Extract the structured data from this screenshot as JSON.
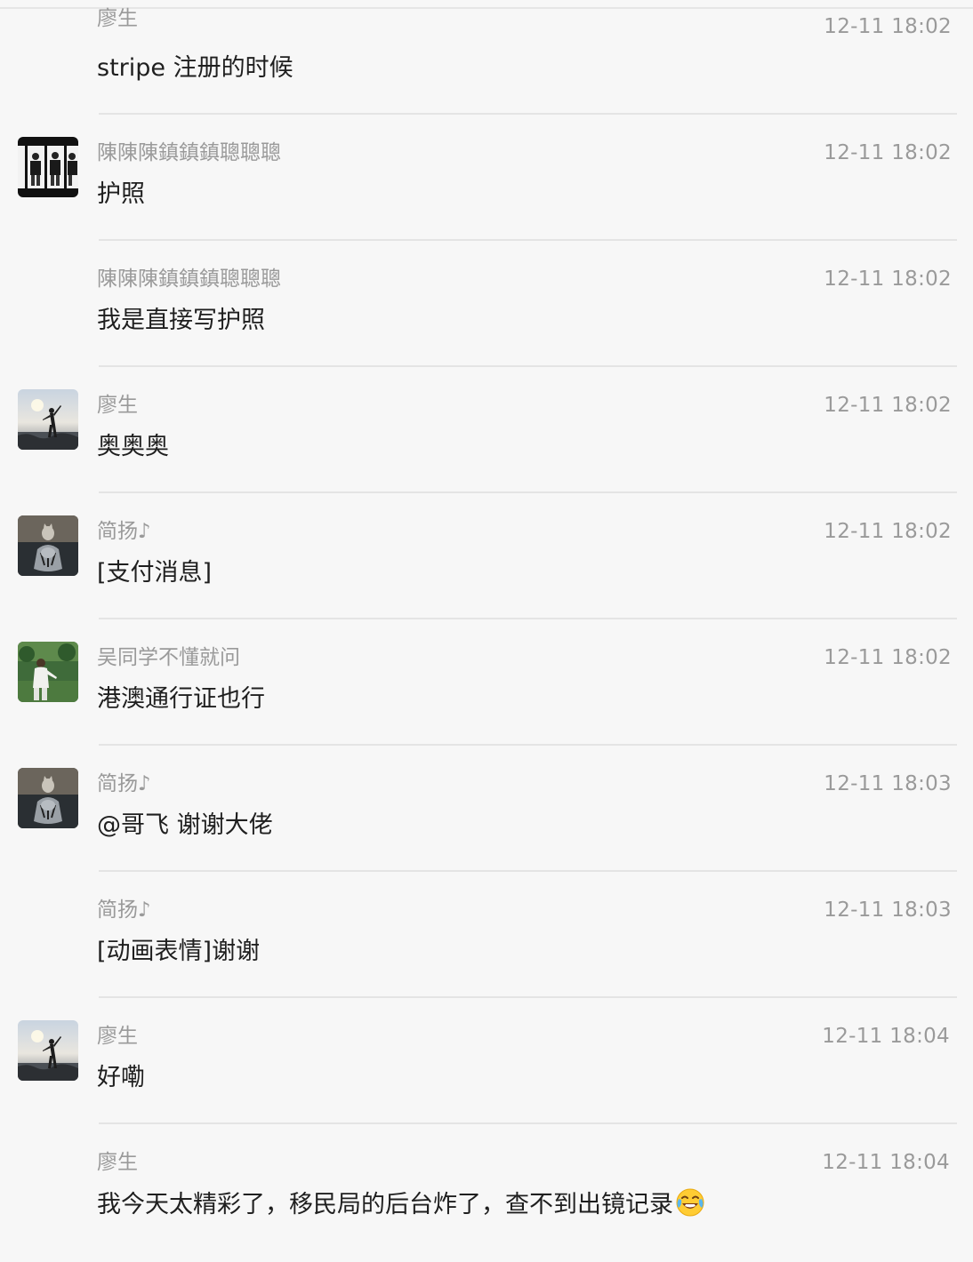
{
  "messages": [
    {
      "sender": "廖生",
      "time": "12-11 18:02",
      "text": "stripe 注册的时候"
    },
    {
      "sender": "陳陳陳鎮鎮鎮聰聰聰",
      "time": "12-11 18:02",
      "text": "护照",
      "avatar": "avatar-three-people-photo"
    },
    {
      "sender": "陳陳陳鎮鎮鎮聰聰聰",
      "time": "12-11 18:02",
      "text": "我是直接写护照"
    },
    {
      "sender": "廖生",
      "time": "12-11 18:02",
      "text": "奥奥奥",
      "avatar": "avatar-silhouette-sunset-photo"
    },
    {
      "sender": "简扬♪",
      "time": "12-11 18:02",
      "text": "[支付消息]",
      "avatar": "avatar-cat-tiger-reflection-photo"
    },
    {
      "sender": "吴同学不懂就问",
      "time": "12-11 18:02",
      "text": "港澳通行证也行",
      "avatar": "avatar-person-in-garden-photo"
    },
    {
      "sender": "简扬♪",
      "time": "12-11 18:03",
      "text": "@哥飞 谢谢大佬",
      "avatar": "avatar-cat-tiger-reflection-photo"
    },
    {
      "sender": "简扬♪",
      "time": "12-11 18:03",
      "text": "[动画表情]谢谢"
    },
    {
      "sender": "廖生",
      "time": "12-11 18:04",
      "text": "好嘞",
      "avatar": "avatar-silhouette-sunset-photo"
    },
    {
      "sender": "廖生",
      "time": "12-11 18:04",
      "text": "我今天太精彩了，移民局的后台炸了，查不到出镜记录",
      "emoji": "face-with-tears-of-joy-emoji"
    }
  ]
}
